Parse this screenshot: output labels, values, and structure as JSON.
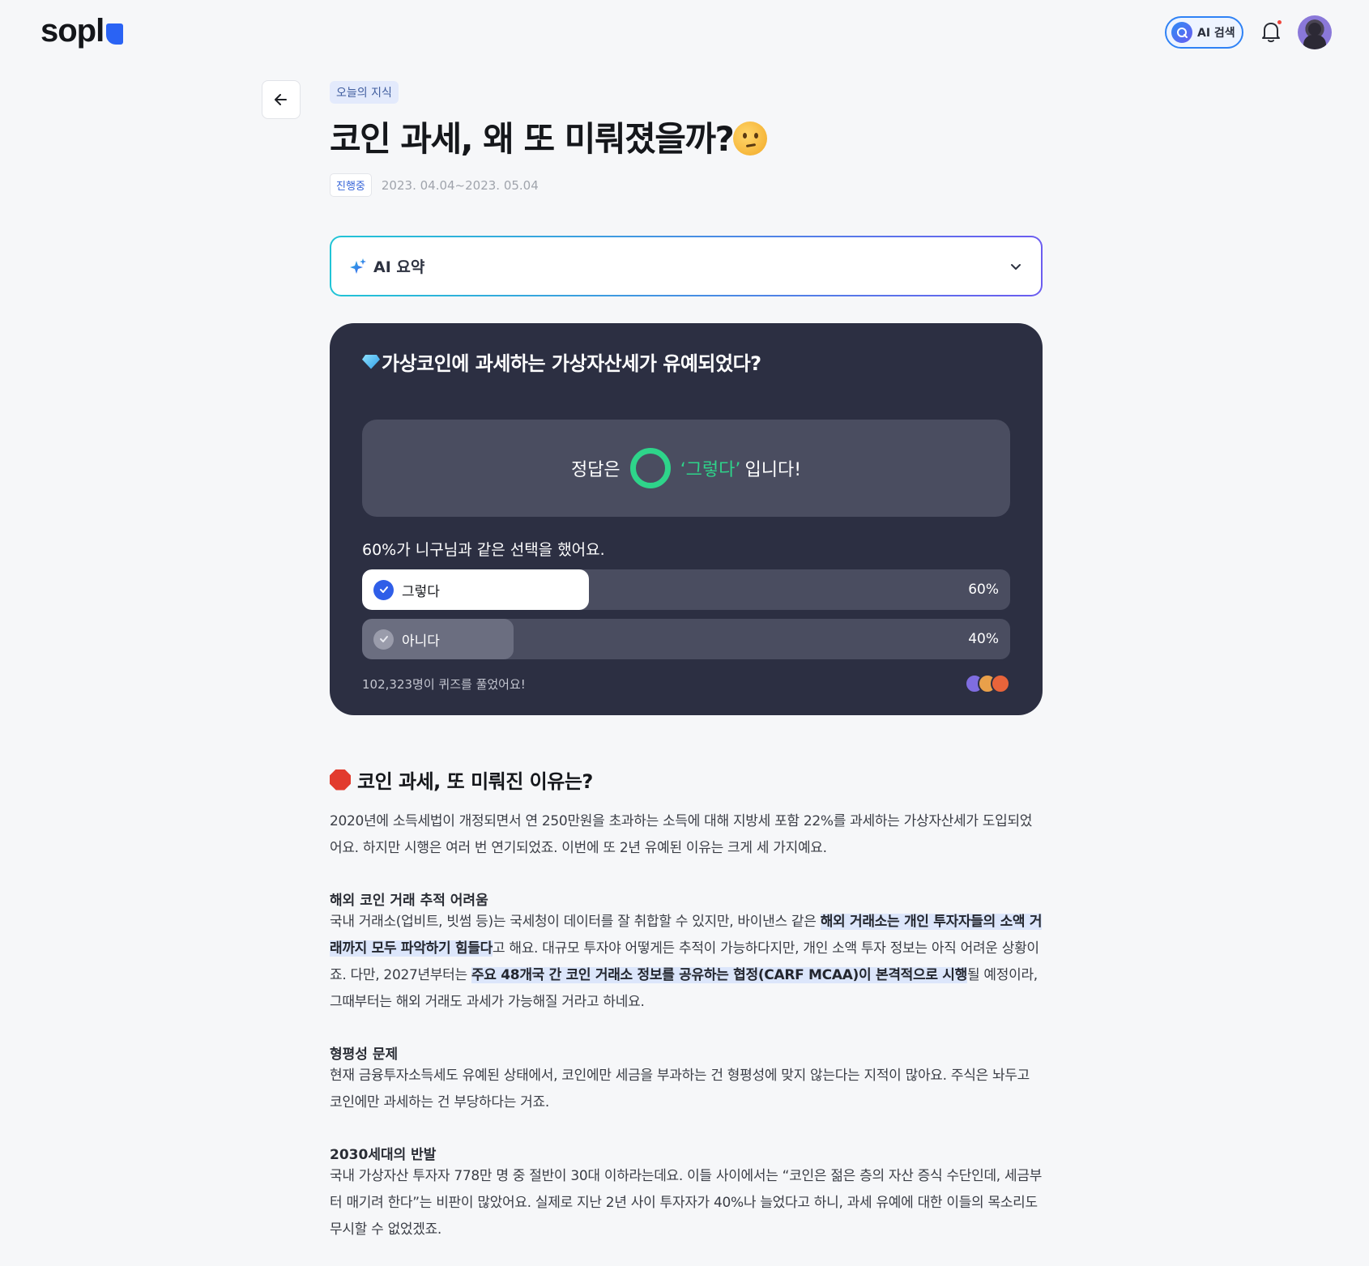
{
  "header": {
    "logo_text": "sopl",
    "ai_search_label": "AI 검색"
  },
  "article": {
    "category": "오늘의 지식",
    "title": "코인 과세, 왜 또 미뤄졌을까?",
    "status": "진행중",
    "period": "2023. 04.04~2023. 05.04",
    "ai_summary_label": "AI 요약"
  },
  "quiz": {
    "question": "가상코인에 과세하는 가상자산세가 유예되었다?",
    "answer_prefix": "정답은",
    "answer_value": "‘그렇다’",
    "answer_suffix": "입니다!",
    "same_choice_text": "60%가 니구님과 같은 선택을 했어요.",
    "options": [
      {
        "label": "그렇다",
        "percent_text": "60%",
        "share": 0.6,
        "selected": true
      },
      {
        "label": "아니다",
        "percent_text": "40%",
        "share": 0.4,
        "selected": false
      }
    ],
    "participants_text": "102,323명이 퀴즈를 풀었어요!"
  },
  "section": {
    "title": "코인 과세, 또 미뤄진 이유는?",
    "intro": "2020년에 소득세법이 개정되면서 연 250만원을 초과하는 소득에 대해 지방세 포함 22%를 과세하는 가상자산세가 도입되었어요. 하지만 시행은 여러 번 연기되었죠. 이번에 또 2년 유예된 이유는 크게 세 가지예요.",
    "reason1": {
      "heading": "해외 코인 거래 추적 어려움",
      "part1": "국내 거래소(업비트, 빗썸 등)는 국세청이 데이터를 잘 취합할 수 있지만, 바이낸스 같은 ",
      "highlight1": "해외 거래소는 개인 투자자들의 소액 거래까지 모두 파악하기 힘들다",
      "part2": "고 해요. 대규모 투자야 어떻게든 추적이 가능하다지만, 개인 소액 투자 정보는 아직 어려운 상황이죠. 다만, 2027년부터는 ",
      "highlight2": "주요 48개국 간 코인 거래소 정보를 공유하는 협정(CARF MCAA)이 본격적으로 시행",
      "part3": "될 예정이라, 그때부터는 해외 거래도 과세가 가능해질 거라고 하네요."
    },
    "reason2": {
      "heading": "형평성 문제",
      "body": "현재 금융투자소득세도 유예된 상태에서, 코인에만 세금을 부과하는 건 형평성에 맞지 않는다는 지적이 많아요. 주식은 놔두고 코인에만 과세하는 건 부당하다는 거죠."
    },
    "reason3": {
      "heading": "2030세대의 반발",
      "body": "국내 가상자산 투자자 778만 명 중 절반이 30대 이하라는데요. 이들 사이에서는 “코인은 젊은 층의 자산 증식 수단인데, 세금부터 매기려 한다”는 비판이 많았어요. 실제로 지난 2년 사이 투자자가 40%나 늘었다고 하니, 과세 유예에 대한 이들의 목소리도 무시할 수 없었겠죠."
    }
  },
  "colors": {
    "accent_blue": "#2a63f4",
    "quiz_bg": "#2c2f42",
    "correct_green": "#2ed48a",
    "highlight_bg": "#dce6fb"
  }
}
